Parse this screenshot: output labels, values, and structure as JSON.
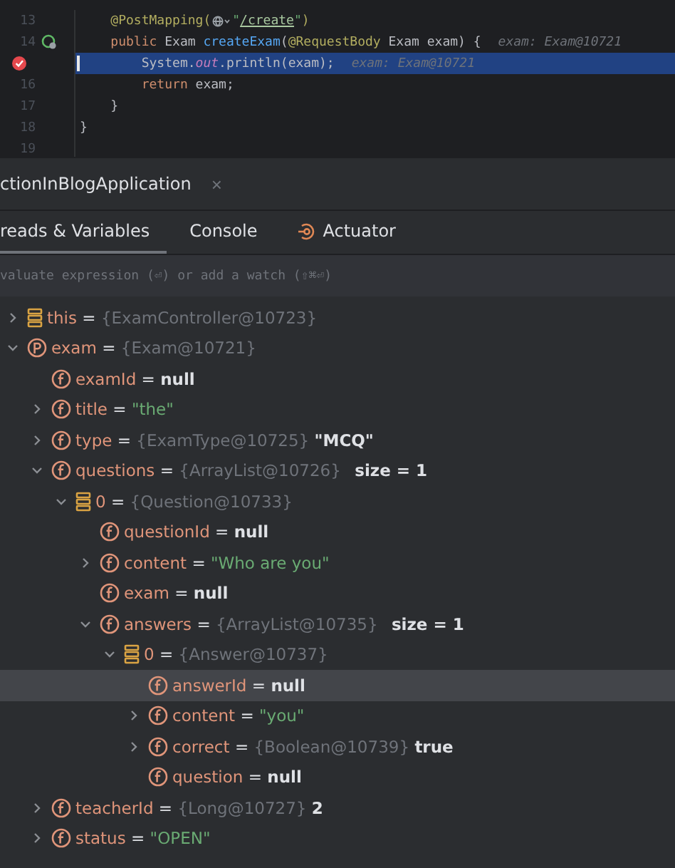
{
  "editor": {
    "lines": [
      {
        "number": "13",
        "segments": [
          {
            "kind": "code",
            "tokens": [
              {
                "text": "    @PostMapping(",
                "kind": "annotation"
              }
            ]
          },
          {
            "kind": "globe"
          },
          {
            "kind": "code",
            "tokens": [
              {
                "text": "\"",
                "kind": "string"
              },
              {
                "text": "/create",
                "kind": "link"
              },
              {
                "text": "\"",
                "kind": "string"
              },
              {
                "text": ")",
                "kind": "annotation"
              }
            ]
          }
        ]
      },
      {
        "number": "14",
        "kind": "bean",
        "segments": [
          {
            "kind": "code",
            "tokens": [
              {
                "text": "    public ",
                "kind": "keyword"
              },
              {
                "text": "Exam ",
                "kind": "plain"
              },
              {
                "text": "createExam",
                "kind": "method"
              },
              {
                "text": "(",
                "kind": "plain"
              },
              {
                "text": "@RequestBody",
                "kind": "annotation"
              },
              {
                "text": " Exam exam) {",
                "kind": "plain"
              }
            ]
          }
        ],
        "hint": "exam: Exam@10721"
      },
      {
        "breakpoint": true,
        "current": true,
        "segments": [
          {
            "kind": "code",
            "tokens": [
              {
                "text": "        System.",
                "kind": "plain"
              },
              {
                "text": "out",
                "kind": "static"
              },
              {
                "text": ".println(exam);",
                "kind": "plain"
              }
            ]
          }
        ],
        "hint": "exam: Exam@10721"
      },
      {
        "number": "16",
        "segments": [
          {
            "kind": "code",
            "tokens": [
              {
                "text": "        return",
                "kind": "keyword"
              },
              {
                "text": " exam;",
                "kind": "plain"
              }
            ]
          }
        ]
      },
      {
        "number": "17",
        "segments": [
          {
            "kind": "code",
            "tokens": [
              {
                "text": "    }",
                "kind": "plain"
              }
            ]
          }
        ]
      },
      {
        "number": "18",
        "segments": [
          {
            "kind": "code",
            "tokens": [
              {
                "text": "}",
                "kind": "plain"
              }
            ]
          }
        ]
      },
      {
        "number": "19"
      }
    ]
  },
  "session": {
    "title": "ctionInBlogApplication",
    "close": "×"
  },
  "tabs": [
    {
      "label": "reads & Variables",
      "selected": true
    },
    {
      "label": "Console",
      "selected": false
    },
    {
      "label": "Actuator",
      "selected": false,
      "kind": "actuator"
    }
  ],
  "evaluate": {
    "placeholder": "valuate expression (⏎) or add a watch (⇧⌘⏎)"
  },
  "variables": {
    "separator": "=",
    "items": [
      {
        "name": "this",
        "kind": "object",
        "ref": "{ExamController@10723}",
        "expanded": false,
        "selected": false
      },
      {
        "name": "exam",
        "kind": "parameter",
        "ref": "{Exam@10721}",
        "expanded": true,
        "selected": false,
        "children": [
          {
            "name": "examId",
            "kind": "field",
            "value": "null",
            "selected": false
          },
          {
            "name": "title",
            "kind": "field",
            "string_value": "\"the\"",
            "expanded": false,
            "selected": false
          },
          {
            "name": "type",
            "kind": "field",
            "ref": "{ExamType@10725}",
            "value": "\"MCQ\"",
            "expanded": false,
            "selected": false
          },
          {
            "name": "questions",
            "kind": "field",
            "ref": "{ArrayList@10726}",
            "size": "size = 1",
            "expanded": true,
            "selected": false,
            "children": [
              {
                "name": "0",
                "kind": "object",
                "ref": "{Question@10733}",
                "expanded": true,
                "selected": false,
                "children": [
                  {
                    "name": "questionId",
                    "kind": "field",
                    "value": "null",
                    "selected": false
                  },
                  {
                    "name": "content",
                    "kind": "field",
                    "string_value": "\"Who are you\"",
                    "expanded": false,
                    "selected": false
                  },
                  {
                    "name": "exam",
                    "kind": "field",
                    "value": "null",
                    "selected": false
                  },
                  {
                    "name": "answers",
                    "kind": "field",
                    "ref": "{ArrayList@10735}",
                    "size": "size = 1",
                    "expanded": true,
                    "selected": false,
                    "children": [
                      {
                        "name": "0",
                        "kind": "object",
                        "ref": "{Answer@10737}",
                        "expanded": true,
                        "selected": false,
                        "children": [
                          {
                            "name": "answerId",
                            "kind": "field",
                            "value": "null",
                            "selected": true
                          },
                          {
                            "name": "content",
                            "kind": "field",
                            "string_value": "\"you\"",
                            "expanded": false,
                            "selected": false
                          },
                          {
                            "name": "correct",
                            "kind": "field",
                            "ref": "{Boolean@10739}",
                            "value": "true",
                            "expanded": false,
                            "selected": false
                          },
                          {
                            "name": "question",
                            "kind": "field",
                            "value": "null",
                            "selected": false
                          }
                        ]
                      }
                    ]
                  }
                ]
              }
            ]
          },
          {
            "name": "teacherId",
            "kind": "field",
            "ref": "{Long@10727}",
            "value": "2",
            "expanded": false,
            "selected": false
          },
          {
            "name": "status",
            "kind": "field",
            "string_value": "\"OPEN\"",
            "expanded": false,
            "selected": false
          }
        ]
      }
    ]
  }
}
